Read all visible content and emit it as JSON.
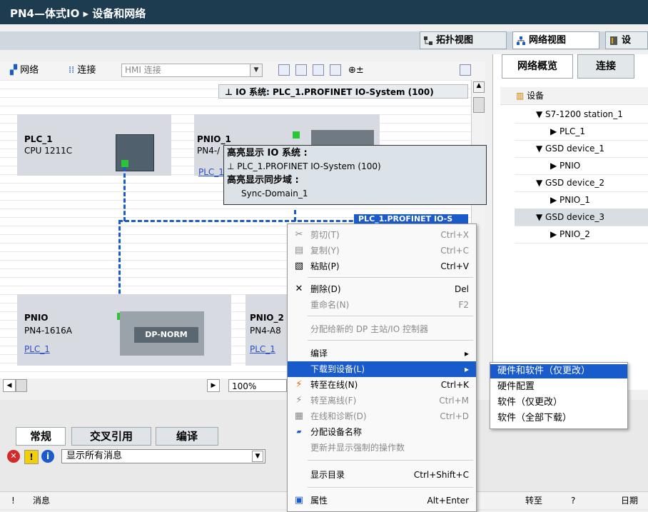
{
  "window": {
    "title": "PN4—体式IO ▸ 设备和网络"
  },
  "views": {
    "topology": "拓扑视图",
    "network": "网络视图",
    "device": "设"
  },
  "toolbar": {
    "network": "网络",
    "connect": "连接",
    "hmi_placeholder": "HMI 连接",
    "zoom_icon": "⊕±"
  },
  "io_system_label": "IO 系统: PLC_1.PROFINET IO-System (100)",
  "devices": {
    "plc1": {
      "name": "PLC_1",
      "type": "CPU 1211C"
    },
    "pnio1": {
      "name": "PNIO_1",
      "type": "PN4-/",
      "link": "PLC_1"
    },
    "pnio": {
      "name": "PNIO",
      "type": "PN4-1616A",
      "link": "PLC_1",
      "module": "DP-NORM"
    },
    "pnio2": {
      "name": "PNIO_2",
      "type": "PN4-A8",
      "link": "PLC_1"
    }
  },
  "network_line_label": "PLC_1.PROFINET IO-S",
  "highlight": {
    "h1": "高亮显示 IO 系统 :",
    "v1": "PLC_1.PROFINET IO-System (100)",
    "h2": "高亮显示同步域 :",
    "v2": "Sync-Domain_1"
  },
  "context_menu": {
    "cut": {
      "label": "剪切(T)",
      "shortcut": "Ctrl+X"
    },
    "copy": {
      "label": "复制(Y)",
      "shortcut": "Ctrl+C"
    },
    "paste": {
      "label": "粘贴(P)",
      "shortcut": "Ctrl+V"
    },
    "delete": {
      "label": "删除(D)",
      "shortcut": "Del"
    },
    "rename": {
      "label": "重命名(N)",
      "shortcut": "F2"
    },
    "assign": {
      "label": "分配给新的 DP 主站/IO 控制器"
    },
    "compile": {
      "label": "编译"
    },
    "download": {
      "label": "下载到设备(L)"
    },
    "online": {
      "label": "转至在线(N)",
      "shortcut": "Ctrl+K"
    },
    "offline": {
      "label": "转至离线(F)",
      "shortcut": "Ctrl+M"
    },
    "diag": {
      "label": "在线和诊断(D)",
      "shortcut": "Ctrl+D"
    },
    "devname": {
      "label": "分配设备名称"
    },
    "update": {
      "label": "更新并显示强制的操作数"
    },
    "catalog": {
      "label": "显示目录",
      "shortcut": "Ctrl+Shift+C"
    },
    "props": {
      "label": "属性",
      "shortcut": "Alt+Enter"
    }
  },
  "submenu": [
    "硬件和软件（仅更改）",
    "硬件配置",
    "软件（仅更改）",
    "软件（全部下载）"
  ],
  "overview": {
    "tab1": "网络概览",
    "tab2": "连接",
    "header": "设备",
    "rows": [
      "S7-1200 station_1",
      "PLC_1",
      "GSD device_1",
      "PNIO",
      "GSD device_2",
      "PNIO_1",
      "GSD device_3",
      "PNIO_2"
    ]
  },
  "zoom": "100%",
  "bottom": {
    "tab1": "常规",
    "tab2": "交叉引用",
    "tab3": "编译",
    "filter": "显示所有消息"
  },
  "status": {
    "msg": "消息",
    "goto": "转至",
    "q": "?",
    "date": "日期",
    "bang": "!"
  }
}
